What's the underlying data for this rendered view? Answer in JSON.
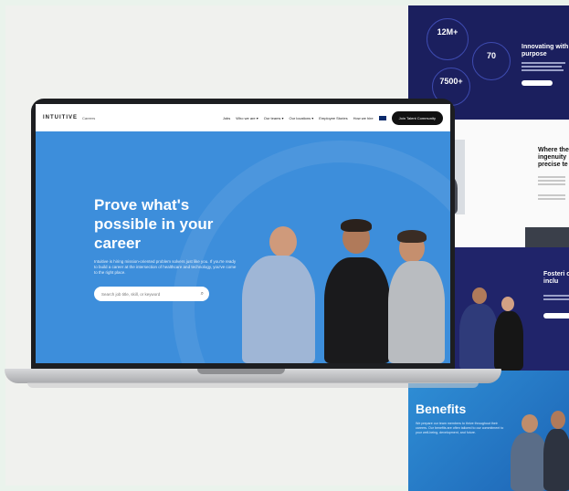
{
  "laptop": {
    "nav": {
      "logo": "INTUITIVE",
      "logo_sub": "Careers",
      "menu": [
        "Jobs",
        "Who we are ▾",
        "Our teams ▾",
        "Our locations ▾",
        "Employee Stories",
        "How we hire"
      ],
      "join_label": "Join Talent Community"
    },
    "hero": {
      "headline": "Prove what's possible in your career",
      "subcopy": "Intuitive is hiring mission-oriented problem solvers just like you. If you're ready to build a career at the intersection of healthcare and technology, you've come to the right place.",
      "search_placeholder": "Search job title, skill, or keyword"
    }
  },
  "panels": {
    "stats": [
      {
        "value": "12M+",
        "text": ""
      },
      {
        "value": "70",
        "text": ""
      },
      {
        "value": "7500+",
        "text": ""
      }
    ],
    "p1_title": "Innovating with purpose",
    "p2_title": "Where the ingenuity precise te",
    "p3_title": "Fosteri of inclu",
    "p4_title": "Benefits",
    "p4_text": "We prepare our team members to thrive throughout their careers. Our benefits are often tailored to our commitment to your well-being, development, and future."
  }
}
